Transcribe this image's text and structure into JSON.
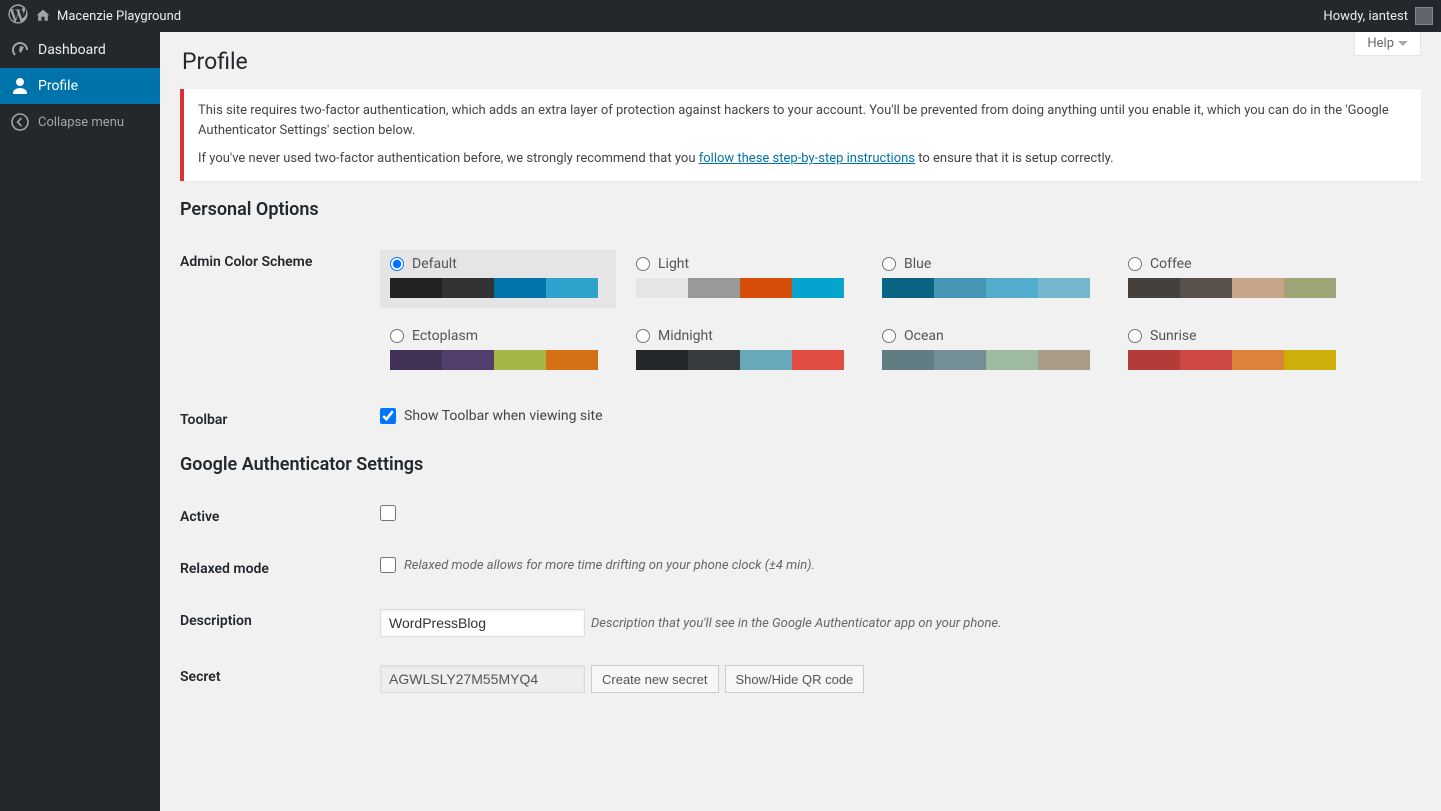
{
  "adminbar": {
    "site_name": "Macenzie Playground",
    "howdy": "Howdy, iantest"
  },
  "sidebar": {
    "dashboard": "Dashboard",
    "profile": "Profile",
    "collapse": "Collapse menu"
  },
  "help_label": "Help",
  "page_title": "Profile",
  "notice": {
    "p1": "This site requires two-factor authentication, which adds an extra layer of protection against hackers to your account. You'll be prevented from doing anything until you enable it, which you can do in the 'Google Authenticator Settings' section below.",
    "p2_a": "If you've never used two-factor authentication before, we strongly recommend that you ",
    "p2_link": "follow these step-by-step instructions",
    "p2_b": " to ensure that it is setup correctly."
  },
  "sections": {
    "personal": "Personal Options",
    "ga": "Google Authenticator Settings"
  },
  "labels": {
    "admin_color_scheme": "Admin Color Scheme",
    "toolbar": "Toolbar",
    "toolbar_option": "Show Toolbar when viewing site",
    "active": "Active",
    "relaxed": "Relaxed mode",
    "relaxed_hint": "Relaxed mode allows for more time drifting on your phone clock (±4 min).",
    "description": "Description",
    "description_hint": "Description that you'll see in the Google Authenticator app on your phone.",
    "secret": "Secret"
  },
  "schemes": [
    {
      "name": "Default",
      "selected": true,
      "colors": [
        "#222222",
        "#333333",
        "#0073aa",
        "#2ea2cc"
      ]
    },
    {
      "name": "Light",
      "selected": false,
      "colors": [
        "#e5e5e5",
        "#999999",
        "#d64e07",
        "#04a4cc"
      ]
    },
    {
      "name": "Blue",
      "selected": false,
      "colors": [
        "#096484",
        "#4796b3",
        "#52accc",
        "#74b6ce"
      ]
    },
    {
      "name": "Coffee",
      "selected": false,
      "colors": [
        "#46403c",
        "#59524c",
        "#c7a589",
        "#9ea476"
      ]
    },
    {
      "name": "Ectoplasm",
      "selected": false,
      "colors": [
        "#413256",
        "#523f6d",
        "#a3b745",
        "#d46f15"
      ]
    },
    {
      "name": "Midnight",
      "selected": false,
      "colors": [
        "#25282b",
        "#363b3f",
        "#69a8bb",
        "#e14d43"
      ]
    },
    {
      "name": "Ocean",
      "selected": false,
      "colors": [
        "#627c83",
        "#738e96",
        "#9ebaa0",
        "#aa9d88"
      ]
    },
    {
      "name": "Sunrise",
      "selected": false,
      "colors": [
        "#b43c38",
        "#cf4944",
        "#dd823b",
        "#ccaf0b"
      ]
    }
  ],
  "ga": {
    "description_value": "WordPressBlog",
    "secret_value": "AGWLSLY27M55MYQ4",
    "create_secret": "Create new secret",
    "toggle_qr": "Show/Hide QR code"
  }
}
